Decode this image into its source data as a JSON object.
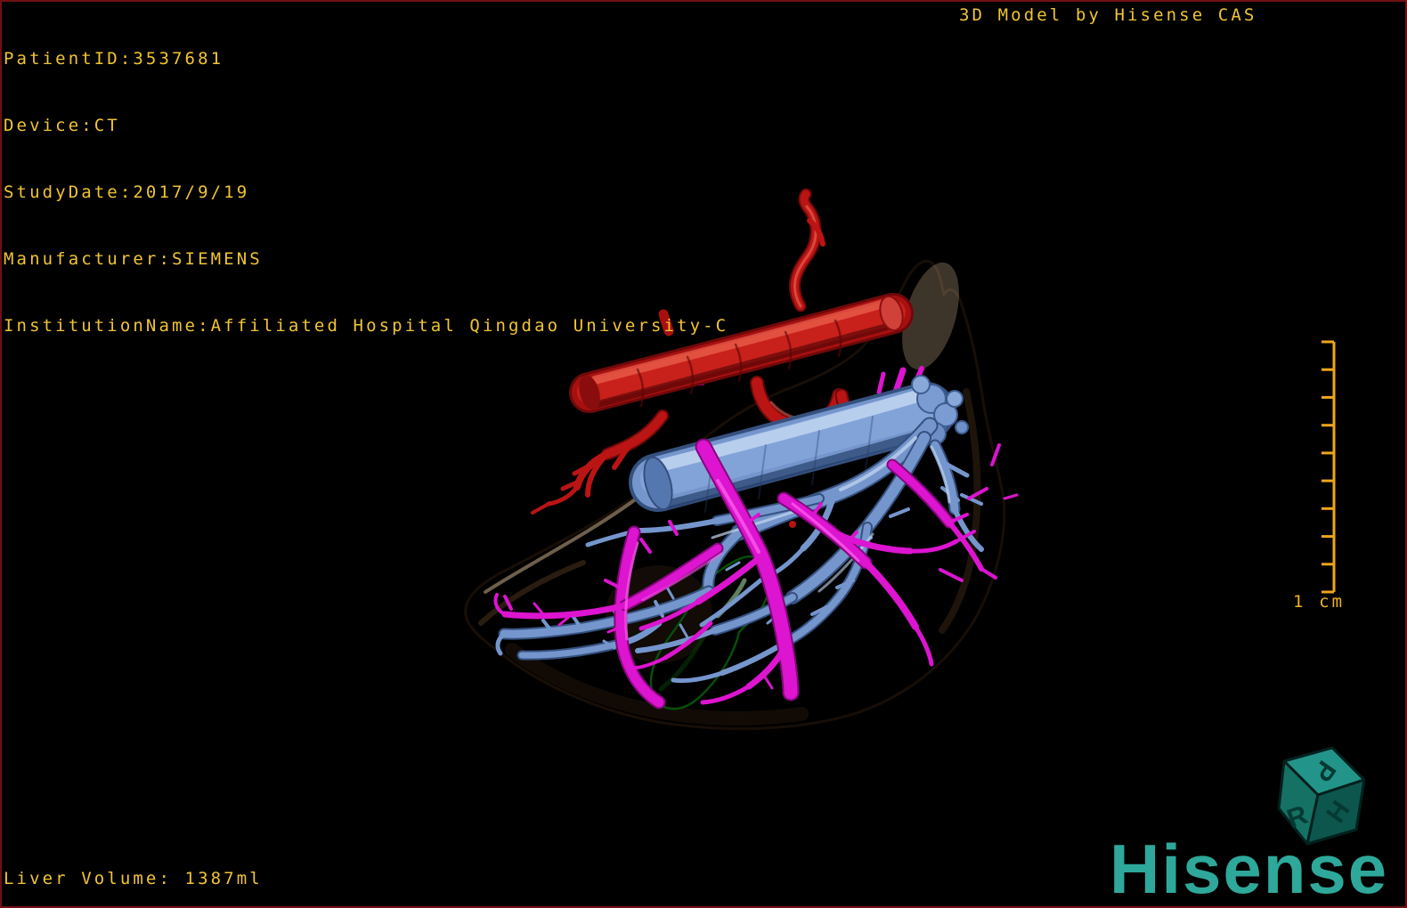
{
  "header": {
    "patient_info_lines": [
      "PatientID:3537681",
      "Device:CT",
      "StudyDate:2017/9/19",
      "Manufacturer:SIEMENS",
      "InstitutionName:Affiliated Hospital Qingdao University-C"
    ],
    "watermark": "3D Model by Hisense CAS"
  },
  "viewport": {
    "scale_bar": {
      "label": "1 cm",
      "ticks": 10
    },
    "orientation_cube": {
      "top": "P",
      "left": "R",
      "right": "H"
    },
    "structures": [
      {
        "name": "liver",
        "color": "#a9815a"
      },
      {
        "name": "hepatic-artery",
        "color": "#bb1414"
      },
      {
        "name": "portal-vein",
        "color": "#7596cd"
      },
      {
        "name": "hepatic-vein",
        "color": "#dd14d0"
      },
      {
        "name": "lesion",
        "color": "#1fa81f"
      }
    ]
  },
  "footer": {
    "liver_volume": "Liver Volume: 1387ml"
  },
  "branding": {
    "logo_text": "Hisense"
  },
  "colors": {
    "background": "#000000",
    "border": "#701014",
    "info_text": "#f1c434",
    "scale_bar": "#efa51a",
    "logo": "#2ea89a"
  }
}
